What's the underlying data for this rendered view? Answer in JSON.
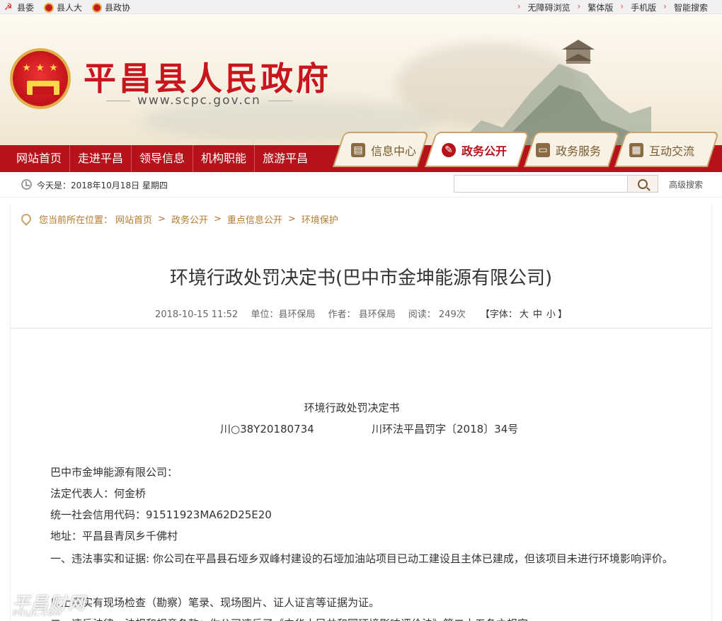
{
  "topbar": {
    "left": [
      {
        "label": "县委",
        "icon": "party-emblem-icon"
      },
      {
        "label": "县人大",
        "icon": "national-emblem-icon"
      },
      {
        "label": "县政协",
        "icon": "cppcc-emblem-icon"
      }
    ],
    "right": [
      "无障碍浏览",
      "繁体版",
      "手机版",
      "智能搜索"
    ]
  },
  "header": {
    "title": "平昌县人民政府",
    "url": "www.scpc.gov.cn"
  },
  "nav": [
    "网站首页",
    "走进平昌",
    "领导信息",
    "机构职能",
    "旅游平昌"
  ],
  "tabs": [
    {
      "label": "信息中心",
      "icon": "document-icon",
      "active": false
    },
    {
      "label": "政务公开",
      "icon": "megaphone-icon",
      "active": true
    },
    {
      "label": "政务服务",
      "icon": "monitor-icon",
      "active": false
    },
    {
      "label": "互动交流",
      "icon": "chat-icon",
      "active": false
    }
  ],
  "infobar": {
    "date": "今天是：2018年10月18日 星期四",
    "search_placeholder": "",
    "advanced": "高级搜索"
  },
  "breadcrumb": {
    "prefix": "您当前所在位置：",
    "items": [
      "网站首页",
      "政务公开",
      "重点信息公开",
      "环境保护"
    ]
  },
  "article": {
    "title": "环境行政处罚决定书(巴中市金坤能源有限公司)",
    "datetime": "2018-10-15 11:52",
    "unit": "单位：县环保局",
    "author": "作者： 县环保局",
    "views": "阅读： 249次",
    "font_label": "【字体：",
    "font_large": "大",
    "font_medium": "中",
    "font_small": "小",
    "font_close": "】",
    "doc_title": "环境行政处罚决定书",
    "doc_no_left": "川○38Y20180734",
    "doc_no_right": "川环法平昌罚字〔2018〕34号",
    "paragraphs": [
      "巴中市金坤能源有限公司：",
      "法定代表人：何金桥",
      "统一社会信用代码：91511923MA62D25E20",
      "地址：平昌县青凤乡千佛村",
      "一、违法事实和证据: 你公司在平昌县石垭乡双峰村建设的石垭加油站项目已动工建设且主体已建成，但该项目未进行环境影响评价。",
      "以上事实有现场检查（勘察）笔录、现场图片、证人证言等证据为证。",
      "二、违反法律、法规和规章条款：你公司违反了《中华人民共和国环境影响评价法》第二十五条之规定。"
    ]
  },
  "watermark": {
    "main": "平昌财网",
    "sub": "PCLJL.COM"
  }
}
